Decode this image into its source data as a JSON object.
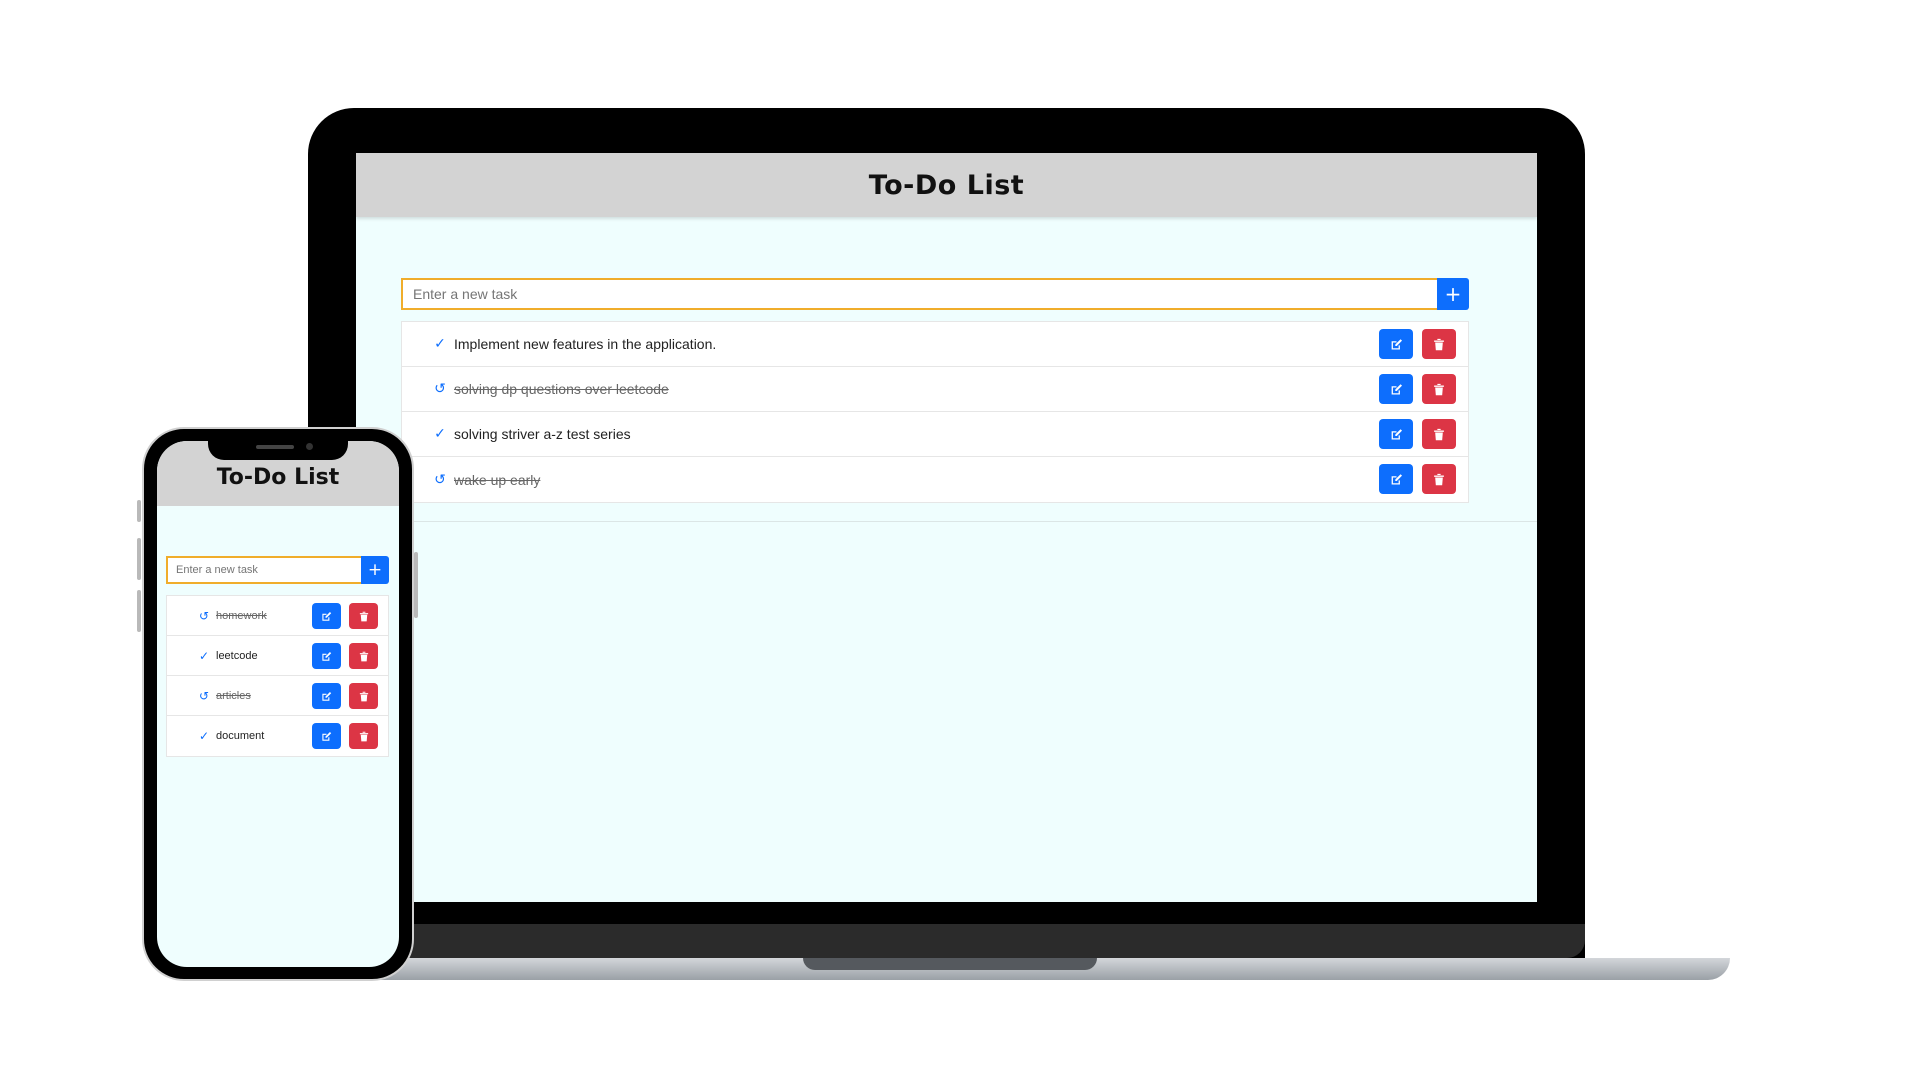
{
  "app": {
    "title": "To-Do List",
    "input_placeholder": "Enter a new task",
    "add_button_label": "+",
    "colors": {
      "header_bg": "#d3d3d3",
      "body_bg": "#effefe",
      "primary": "#0d6efd",
      "danger": "#dc3545",
      "input_border": "#f0ad2b"
    }
  },
  "desktop": {
    "tasks": [
      {
        "text": "Implement new features in the application.",
        "status": "pending",
        "status_icon": "check-icon",
        "glyph": "✓"
      },
      {
        "text": "solving dp questions over leetcode",
        "status": "done",
        "status_icon": "undo-icon",
        "glyph": "↺"
      },
      {
        "text": "solving striver a-z test series",
        "status": "pending",
        "status_icon": "check-icon",
        "glyph": "✓"
      },
      {
        "text": "wake up early",
        "status": "done",
        "status_icon": "undo-icon",
        "glyph": "↺"
      }
    ]
  },
  "mobile": {
    "tasks": [
      {
        "text": "homework",
        "status": "done",
        "status_icon": "undo-icon",
        "glyph": "↺"
      },
      {
        "text": "leetcode",
        "status": "pending",
        "status_icon": "check-icon",
        "glyph": "✓"
      },
      {
        "text": "articles",
        "status": "done",
        "status_icon": "undo-icon",
        "glyph": "↺"
      },
      {
        "text": "document",
        "status": "pending",
        "status_icon": "check-icon",
        "glyph": "✓"
      }
    ]
  }
}
